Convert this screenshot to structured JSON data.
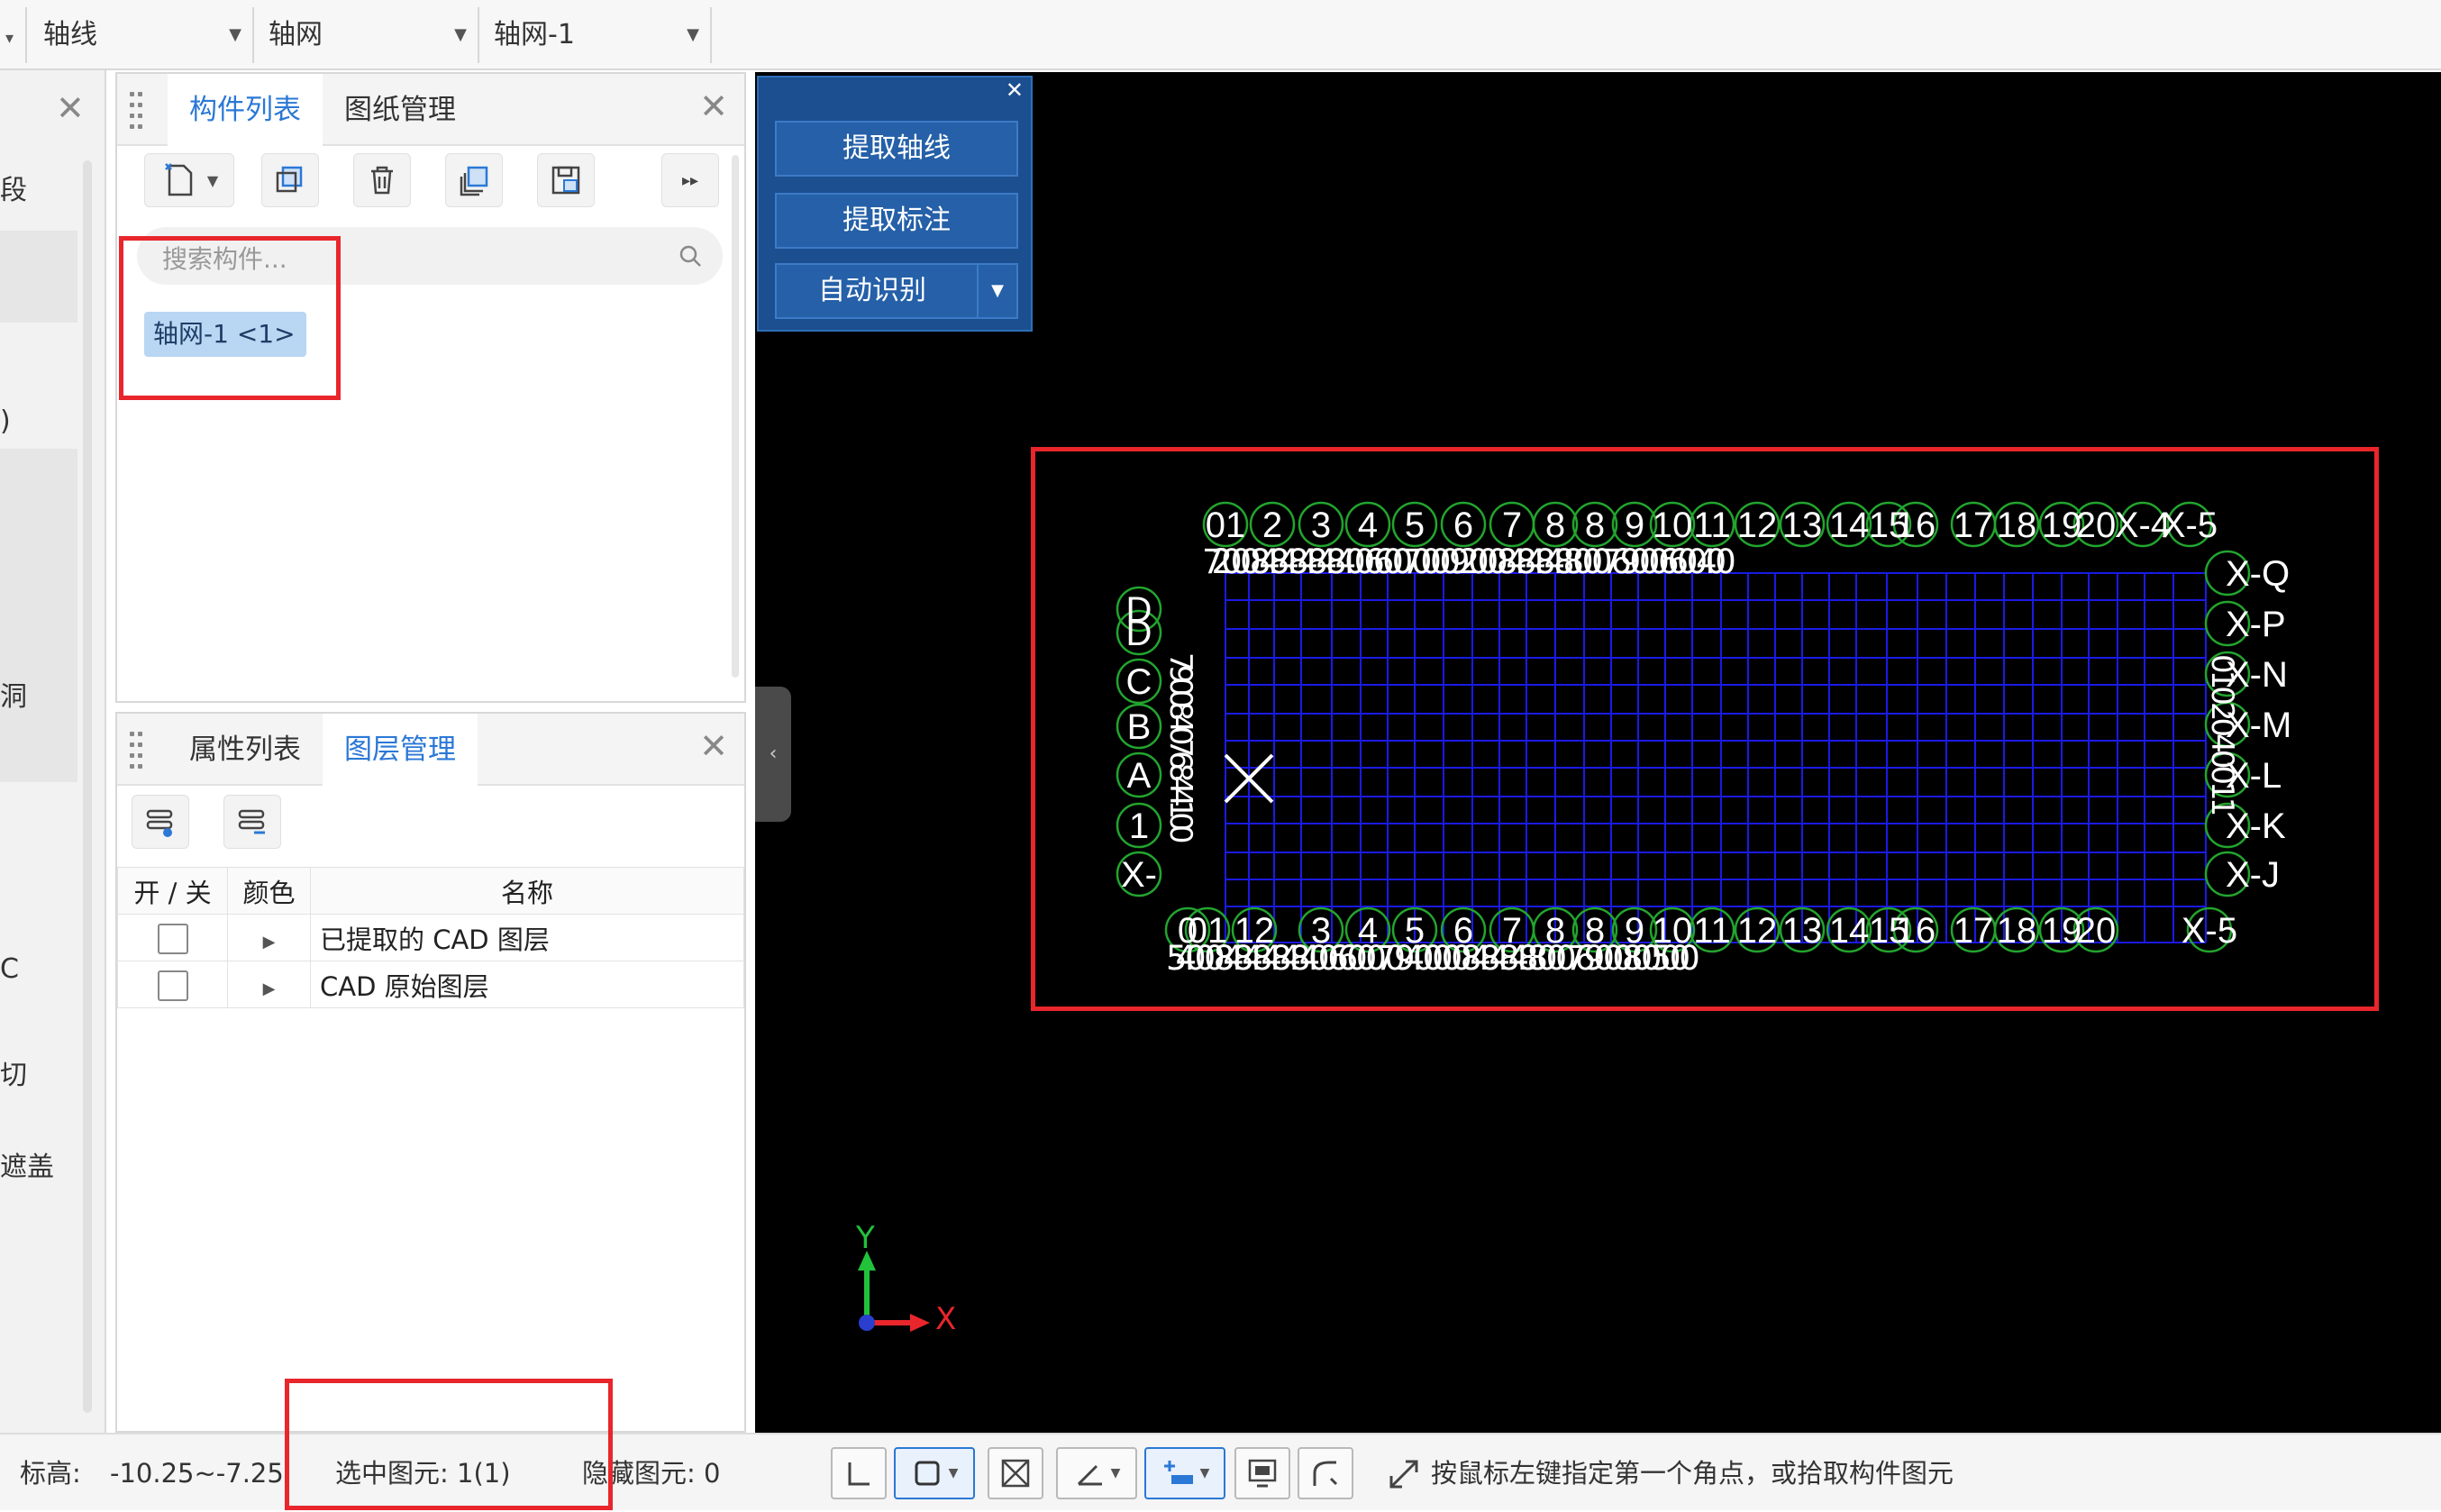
{
  "toolbar": {
    "combo1": "轴线",
    "combo2": "轴网",
    "combo3": "轴网-1"
  },
  "left_strip": {
    "chars": [
      "段",
      ")",
      "洞",
      "C",
      "切",
      "遮盖"
    ]
  },
  "component_panel": {
    "tabs": [
      "构件列表",
      "图纸管理"
    ],
    "active_tab": "构件列表",
    "search_placeholder": "搜索构件...",
    "items": [
      {
        "label": "轴网-1 <1>"
      }
    ]
  },
  "layer_panel": {
    "tabs": [
      "属性列表",
      "图层管理"
    ],
    "active_tab": "图层管理",
    "columns": [
      "开 / 关",
      "颜色",
      "名称"
    ],
    "rows": [
      {
        "name": "已提取的 CAD 图层",
        "checked": false
      },
      {
        "name": "CAD 原始图层",
        "checked": false
      }
    ]
  },
  "float_panel": {
    "buttons": [
      "提取轴线",
      "提取标注",
      "自动识别"
    ]
  },
  "drawing": {
    "top_axis_labels": [
      "01",
      "2",
      "3",
      "4",
      "5",
      "6",
      "7",
      "8",
      "8",
      "9",
      "10",
      "11",
      "12",
      "13",
      "14",
      "15",
      "16",
      "17",
      "18",
      "19",
      "20",
      "X-4",
      "X-5"
    ],
    "bottom_axis_labels": [
      "0",
      "01",
      "12",
      "3",
      "4",
      "5",
      "6",
      "7",
      "8",
      "8",
      "9",
      "10",
      "11",
      "12",
      "13",
      "14",
      "15",
      "16",
      "17",
      "18",
      "19",
      "20",
      "X-5"
    ],
    "left_axis_labels": [
      "D",
      "D",
      "C",
      "B",
      "A",
      "1",
      "X-"
    ],
    "right_axis_labels": [
      "X-Q",
      "X-P",
      "X-N",
      "X-M",
      "X-L",
      "X-K",
      "X-J"
    ],
    "top_dims": "7200084848484840066007000092000848484880007690006600400",
    "bottom_dims": "5400084848484840066000709400000848484880007690008005000",
    "left_dims": "790084076844100",
    "right_dims": "0102040011"
  },
  "axis_indicator": {
    "x": "X",
    "y": "Y"
  },
  "status_bar": {
    "elevation_label": "标高:",
    "elevation_value": "-10.25~-7.25",
    "selected": "选中图元: 1(1)",
    "hidden": "隐藏图元: 0",
    "hint": "按鼠标左键指定第一个角点，或拾取构件图元"
  },
  "colors": {
    "accent": "#2b78d6",
    "highlight": "#e8262b",
    "grid": "#1a1ae6",
    "bubble": "#22a52e",
    "float_panel_bg": "#1c4f8f"
  }
}
